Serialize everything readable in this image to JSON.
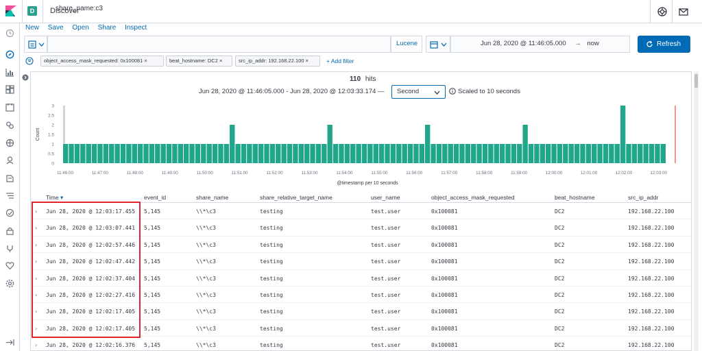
{
  "header": {
    "space_initial": "D",
    "app_title": "Discover",
    "icons": [
      "kibana-logo-icon",
      "help-icon",
      "mail-icon"
    ]
  },
  "nav_icons": [
    "clock-icon",
    "compass-icon",
    "visualize-icon",
    "dashboard-icon",
    "canvas-icon",
    "maps-icon",
    "ml-icon",
    "graph-icon",
    "apm-icon",
    "logs-icon",
    "uptime-icon",
    "siem-icon",
    "devtools-icon",
    "monitoring-icon",
    "management-icon",
    "collapse-icon"
  ],
  "menu": {
    "items": [
      "New",
      "Save",
      "Open",
      "Share",
      "Inspect"
    ]
  },
  "search": {
    "query": "share_name:c3",
    "language_label": "Lucene",
    "date_from": "Jun 28, 2020 @ 11:46:05.000",
    "arrow": "→",
    "date_to": "now",
    "refresh_label": "Refresh"
  },
  "filters": {
    "pills": [
      "object_access_mask_requested: 0x100081",
      "beat_hostname: DC2",
      "src_ip_addr: 192.168.22.100"
    ],
    "add_label": "+ Add filter"
  },
  "summary": {
    "hits_count": "110",
    "hits_label": "hits",
    "range_text": "Jun 28, 2020 @ 11:46:05.000 - Jun 28, 2020 @ 12:03:33.174 —",
    "interval": "Second",
    "scaled_text": "Scaled to 10 seconds"
  },
  "chart_data": {
    "type": "bar",
    "title": "",
    "xlabel": "@timestamp per 10 seconds",
    "ylabel": "Count",
    "ylim": [
      0,
      3
    ],
    "y_ticks": [
      "3",
      "2.5",
      "2",
      "1.5",
      "1",
      "0.5",
      "0"
    ],
    "x_ticks": [
      "11:46:00",
      "11:47:00",
      "11:48:00",
      "11:49:00",
      "11:50:00",
      "11:51:00",
      "11:52:00",
      "11:53:00",
      "11:54:00",
      "11:55:00",
      "11:56:00",
      "11:57:00",
      "11:58:00",
      "11:59:00",
      "12:00:00",
      "12:01:00",
      "12:02:00",
      "12:03:00"
    ],
    "bar_count": 105,
    "values": [
      1,
      1,
      1,
      1,
      1,
      1,
      1,
      1,
      1,
      1,
      1,
      1,
      1,
      1,
      1,
      1,
      1,
      1,
      1,
      1,
      1,
      1,
      1,
      1,
      1,
      1,
      1,
      1,
      1,
      1,
      1,
      1,
      1,
      1,
      1,
      1,
      1,
      1,
      1,
      1,
      1,
      1,
      1,
      1,
      1,
      1,
      1,
      1,
      1,
      1,
      1,
      1,
      1,
      1,
      1,
      1,
      1,
      1,
      1,
      1,
      1,
      1,
      1,
      1,
      1,
      1,
      1,
      1,
      1,
      1,
      1,
      1,
      1,
      1,
      1,
      1,
      1,
      1,
      1,
      1,
      1,
      1,
      1,
      1,
      1,
      1,
      1,
      1,
      1,
      1,
      1,
      1,
      1,
      1,
      1,
      1,
      1,
      1,
      1,
      1,
      1,
      1,
      1,
      1,
      1
    ],
    "peaks": [
      {
        "index": 29,
        "value": 2
      },
      {
        "index": 46,
        "value": 2
      },
      {
        "index": 63,
        "value": 2
      },
      {
        "index": 80,
        "value": 2
      },
      {
        "index": 97,
        "value": 3
      }
    ],
    "bar_color": "#20a68b",
    "now_line_color": "#e0242b"
  },
  "table": {
    "columns": [
      "Time",
      "event_id",
      "share_name",
      "share_relative_target_name",
      "user_name",
      "object_access_mask_requested",
      "beat_hostname",
      "src_ip_addr"
    ],
    "rows": [
      [
        "Jun 28, 2020 @ 12:03:17.455",
        "5,145",
        "\\\\*\\c3",
        "testing",
        "test.user",
        "0x100081",
        "DC2",
        "192.168.22.100"
      ],
      [
        "Jun 28, 2020 @ 12:03:07.441",
        "5,145",
        "\\\\*\\c3",
        "testing",
        "test.user",
        "0x100081",
        "DC2",
        "192.168.22.100"
      ],
      [
        "Jun 28, 2020 @ 12:02:57.446",
        "5,145",
        "\\\\*\\c3",
        "testing",
        "test.user",
        "0x100081",
        "DC2",
        "192.168.22.100"
      ],
      [
        "Jun 28, 2020 @ 12:02:47.442",
        "5,145",
        "\\\\*\\c3",
        "testing",
        "test.user",
        "0x100081",
        "DC2",
        "192.168.22.100"
      ],
      [
        "Jun 28, 2020 @ 12:02:37.404",
        "5,145",
        "\\\\*\\c3",
        "testing",
        "test.user",
        "0x100081",
        "DC2",
        "192.168.22.100"
      ],
      [
        "Jun 28, 2020 @ 12:02:27.416",
        "5,145",
        "\\\\*\\c3",
        "testing",
        "test.user",
        "0x100081",
        "DC2",
        "192.168.22.100"
      ],
      [
        "Jun 28, 2020 @ 12:02:17.405",
        "5,145",
        "\\\\*\\c3",
        "testing",
        "test.user",
        "0x100081",
        "DC2",
        "192.168.22.100"
      ],
      [
        "Jun 28, 2020 @ 12:02:17.405",
        "5,145",
        "\\\\*\\c3",
        "testing",
        "test.user",
        "0x100081",
        "DC2",
        "192.168.22.100"
      ],
      [
        "Jun 28, 2020 @ 12:02:16.376",
        "5,145",
        "\\\\*\\c3",
        "testing",
        "test.user",
        "0x100081",
        "DC2",
        "192.168.22.100"
      ]
    ],
    "sort_indicator": "▾",
    "expand_glyph": "›"
  },
  "colors": {
    "accent": "#006bb4",
    "highlight": "#e0242b"
  }
}
